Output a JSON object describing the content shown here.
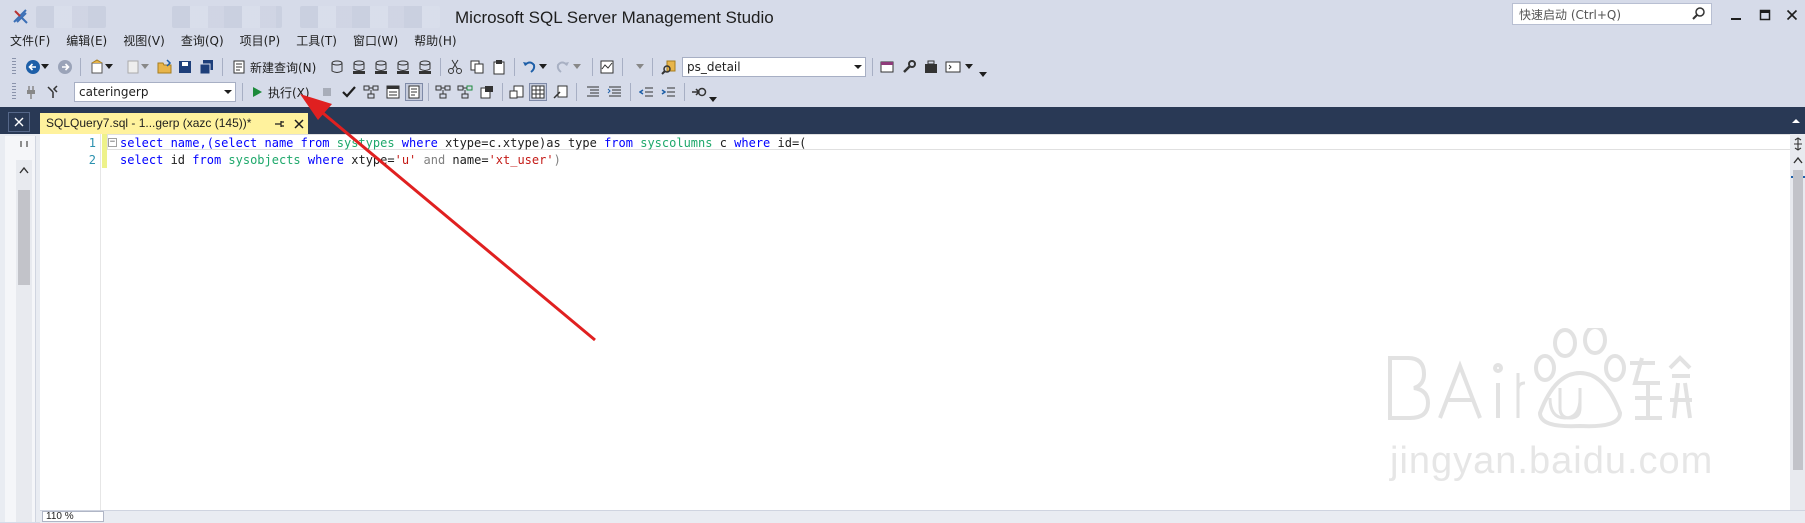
{
  "title": "Microsoft SQL Server Management Studio",
  "quick_launch": {
    "placeholder": "快速启动 (Ctrl+Q)"
  },
  "menu": [
    "文件(F)",
    "编辑(E)",
    "视图(V)",
    "查询(Q)",
    "项目(P)",
    "工具(T)",
    "窗口(W)",
    "帮助(H)"
  ],
  "toolbar1": {
    "new_query_label": "新建查询(N)",
    "solution_combo": "ps_detail"
  },
  "toolbar2": {
    "database_combo": "cateringerp",
    "execute_label": "执行(X)"
  },
  "tab": {
    "title": "SQLQuery7.sql - 1...gerp (xazc (145))*"
  },
  "editor": {
    "line_numbers": [
      "1",
      "2"
    ],
    "line1": {
      "p1": "select name,",
      "p2": "(select name from ",
      "p3": "systypes",
      "p4": " where ",
      "p5": "xtype=c.xtype)as type ",
      "p6": "from",
      "p7": " ",
      "p8": "syscolumns",
      "p9": " c ",
      "p10": "where",
      "p11": " id=("
    },
    "line2": {
      "p1": "select",
      "p2": " id ",
      "p3": "from",
      "p4": " ",
      "p5": "sysobjects",
      "p6": " ",
      "p7": "where",
      "p8": " xtype=",
      "p9": "'u'",
      "p10": " ",
      "p11": "and",
      "p12": " name=",
      "p13": "'xt_user'",
      "p14": ")"
    }
  },
  "status": {
    "zoom": "110 %"
  },
  "watermark": {
    "text": "jingyan.baidu.com"
  },
  "colors": {
    "keyword": "#0000ff",
    "system_object": "#1ea86b",
    "string": "#c41a16",
    "tab_active": "#fff29d",
    "arrow": "#e02020"
  }
}
